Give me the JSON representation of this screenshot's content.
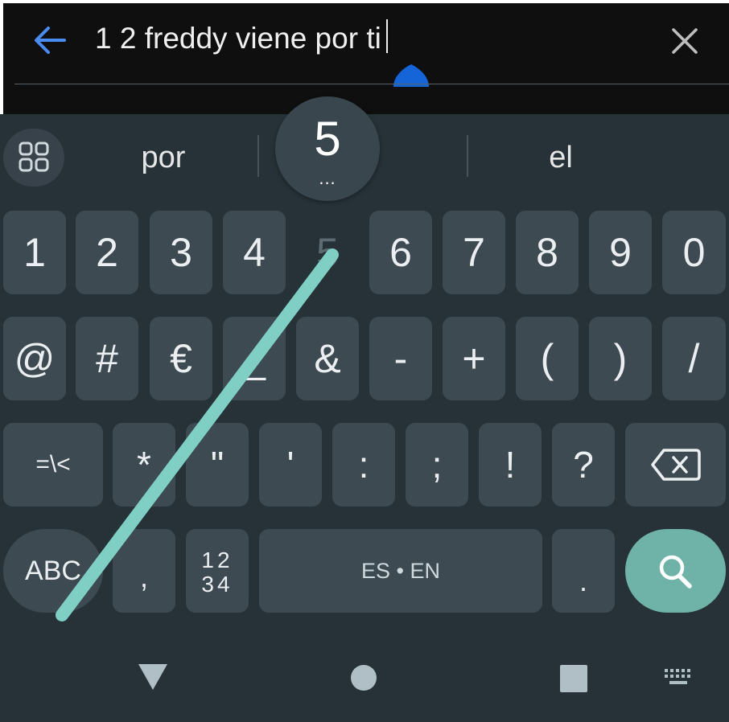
{
  "search": {
    "query": "1 2 freddy viene por ti",
    "back_icon": "arrow-left-icon",
    "clear_icon": "close-icon",
    "accent_color": "#4a8cf0",
    "handle_color": "#1565d8"
  },
  "suggestions": {
    "apps_icon": "grid-icon",
    "left": "por",
    "center": "5",
    "right": "el",
    "popup_key": "5",
    "popup_hint": "..."
  },
  "keyboard": {
    "row1": [
      "1",
      "2",
      "3",
      "4",
      "5",
      "6",
      "7",
      "8",
      "9",
      "0"
    ],
    "row2": [
      "@",
      "#",
      "€",
      "_",
      "&",
      "-",
      "+",
      "(",
      ")",
      "/"
    ],
    "row3": [
      "=\\<",
      "*",
      "\"",
      "'",
      ":",
      ";",
      "!",
      "?"
    ],
    "backspace_icon": "backspace-icon",
    "abc_label": "ABC",
    "comma": ",",
    "numpad_top": "12",
    "numpad_bottom": "34",
    "space_label": "ES • EN",
    "period": ".",
    "search_icon": "search-icon",
    "search_key_color": "#6fb3a8",
    "swipe_trail_color": "#7fcfc4"
  },
  "navbar": {
    "back_icon": "triangle-down-icon",
    "home_icon": "circle-icon",
    "recents_icon": "square-icon",
    "keyboard_icon": "keyboard-icon"
  }
}
